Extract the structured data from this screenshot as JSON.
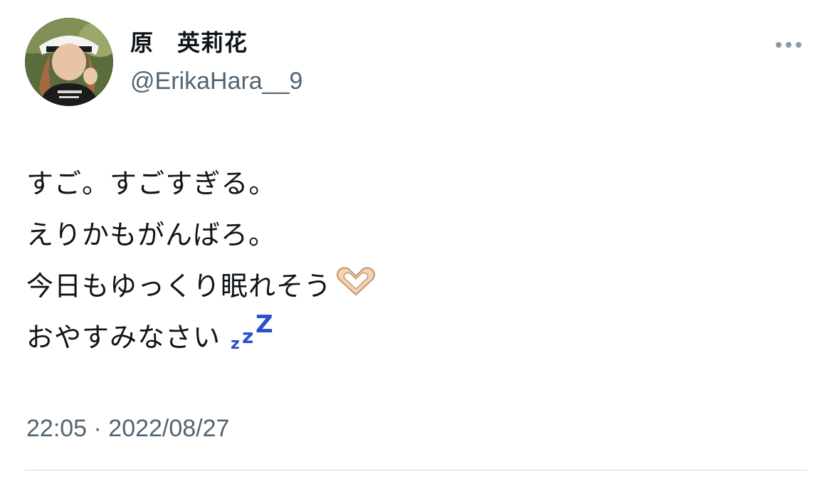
{
  "author": {
    "display_name": "原　英莉花",
    "handle": "@ErikaHara__9"
  },
  "tweet": {
    "lines": [
      "すご。すごすぎる。",
      "えりかもがんばろ。",
      "今日もゆっくり眠れそう",
      "おやすみなさい"
    ],
    "emoji": {
      "heart_hands": "heart-hands-icon",
      "zzz": "zzz-icon"
    },
    "zzz_glyphs": [
      "z",
      "z",
      "Z"
    ],
    "timestamp": "22:05 · 2022/08/27"
  },
  "colors": {
    "text": "#0f1419",
    "secondary": "#536471",
    "zzz": "#2c50c8",
    "divider": "#cfd9de"
  }
}
